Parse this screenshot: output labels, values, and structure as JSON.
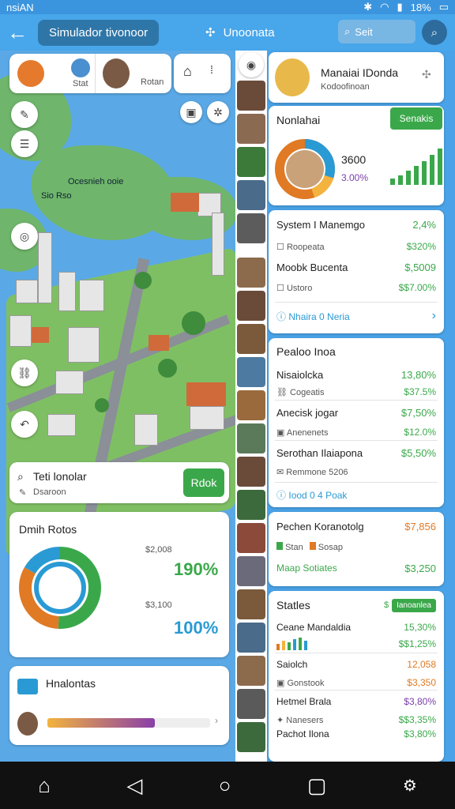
{
  "status": {
    "carrier": "nsiAN",
    "battery": "18%",
    "icons": [
      "bluetooth-icon",
      "wifi-icon",
      "signal-icon",
      "battery-icon"
    ]
  },
  "appbar": {
    "title": "Simulador tivonoor",
    "center_title": "Unoonata",
    "search_placeholder": "Seit"
  },
  "left": {
    "top_card": {
      "label_1": "Stat",
      "label_2": "Rotan"
    },
    "map_labels": {
      "label_1": "Ocesnieh ooie",
      "label_2": "Sio Rso"
    },
    "search_card": {
      "title": "Teti lonolar",
      "subtitle": "Dsaroon",
      "button": "Rdok"
    },
    "chart_card": {
      "title": "Dmih Rotos",
      "value_1_label": "$2,008",
      "value_1": "190%",
      "value_2_label": "$3,100",
      "value_2": "100%"
    },
    "footer_card": {
      "title": "Hnalontas"
    }
  },
  "right": {
    "profile": {
      "name": "Manaiai IDonda",
      "subtitle": "Kodoofinoan"
    },
    "stats_card": {
      "title": "Nonlahai",
      "button": "Senakis",
      "value": "3600",
      "percent": "3.00%"
    },
    "section_1": {
      "rows": [
        {
          "title": "System I Manemgo",
          "value": "2,4%",
          "sub": "Roopeata",
          "sub_value": "$320%"
        },
        {
          "title": "Moobk Bucenta",
          "value": "$,5009",
          "sub": "Ustoro",
          "sub_value": "$$7.00%"
        }
      ],
      "footer": "Nhaira 0 Neria"
    },
    "section_2": {
      "title": "Pealoo Inoa",
      "rows": [
        {
          "title": "Nisaiolcka",
          "value": "13,80%",
          "sub": "Cogeatis",
          "sub_value": "$37.5%"
        },
        {
          "title": "Anecisk jogar",
          "value": "$7,50%",
          "sub": "Anenenets",
          "sub_value": "$12.0%"
        },
        {
          "title": "Serothan Ilaiapona",
          "value": "$5,50%",
          "sub": "Remmone 5206",
          "sub_value": ""
        }
      ],
      "footer": "Iood 0 4 Poak"
    },
    "section_3": {
      "title": "Pechen Koranotolg",
      "value": "$7,856",
      "sub_1": "Stan",
      "sub_2": "Sosap",
      "footer": "Maap Sotiates",
      "footer_value": "$3,250"
    },
    "section_4": {
      "title": "Statles",
      "badge": "Ianoanlea",
      "badge_prefix": "$",
      "rows": [
        {
          "title": "Ceane Mandaldia",
          "value": "15,30%",
          "sub_value": "$$1,25%"
        },
        {
          "title": "Saiolch",
          "value": "12,058",
          "sub": "Gonstook",
          "sub_value": "$3,350"
        },
        {
          "title": "Hetmel Brala",
          "value": "$3,80%",
          "sub": "Nanesers",
          "sub_value": "$$3,35%"
        },
        {
          "title": "Pachot Ilona",
          "value": "$3,80%"
        }
      ]
    }
  },
  "colors": {
    "primary": "#48a6ea",
    "green": "#3aa84a",
    "blue": "#2a9ad4",
    "orange": "#e07a24"
  }
}
